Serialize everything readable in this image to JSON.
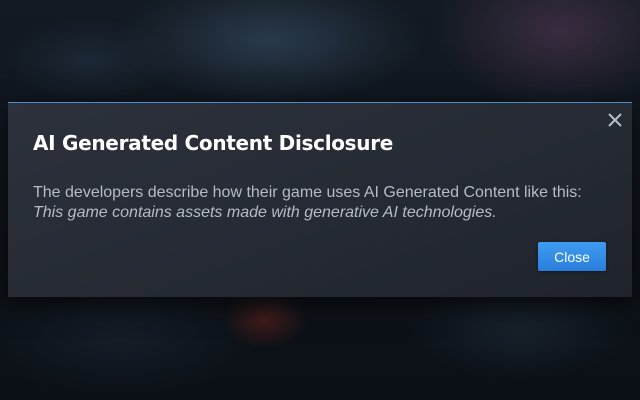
{
  "dialog": {
    "title": "AI Generated Content Disclosure",
    "description": "The developers describe how their game uses AI Generated Content like this:",
    "quote": "This game contains assets made with generative AI technologies.",
    "close_label": "Close",
    "close_icon": "close-icon"
  },
  "colors": {
    "accent_border": "#4a8fc4",
    "button_primary": "#3a8fe8",
    "title_text": "#ffffff",
    "body_text": "#b6bcc4"
  }
}
